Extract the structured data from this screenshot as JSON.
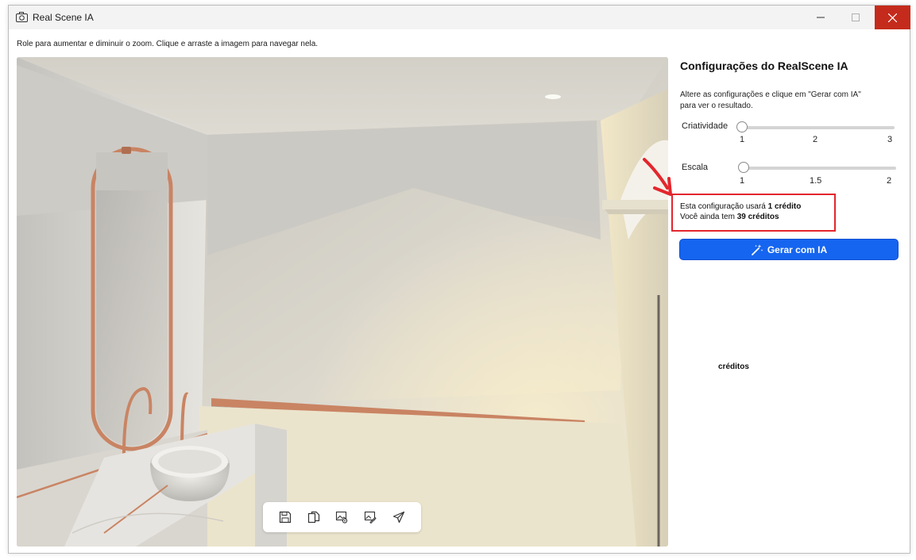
{
  "window": {
    "title": "Real Scene IA",
    "controls": {
      "minimize": "minimize",
      "maximize": "maximize",
      "close": "close"
    }
  },
  "hint": "Role para aumentar e diminuir o zoom. Clique e arraste a imagem para navegar nela.",
  "viewer": {
    "toolbar": [
      {
        "name": "save-button",
        "icon": "floppy-disk-icon"
      },
      {
        "name": "copy-button",
        "icon": "copy-icon"
      },
      {
        "name": "image-settings-button",
        "icon": "image-gear-icon"
      },
      {
        "name": "image-edit-button",
        "icon": "image-edit-icon"
      },
      {
        "name": "send-button",
        "icon": "paper-plane-icon"
      }
    ]
  },
  "panel": {
    "title": "Configurações do RealScene IA",
    "description_line1": "Altere as configurações e clique em \"Gerar com IA\"",
    "description_line2": "para ver o resultado.",
    "sliders": {
      "criatividade": {
        "label": "Criatividade",
        "min": "1",
        "mid": "2",
        "max": "3",
        "value": 1
      },
      "escala": {
        "label": "Escala",
        "min": "1",
        "mid": "1.5",
        "max": "2",
        "value": 1
      }
    },
    "credits": {
      "line1_prefix": "Esta configuração usará ",
      "line1_bold": "1 crédito",
      "line2_prefix": "Você ainda tem ",
      "line2_bold": "39 créditos"
    },
    "generate_label": "Gerar com IA",
    "extra_label": "créditos"
  },
  "colors": {
    "accent": "#1565f0",
    "close": "#c42b1c",
    "highlight": "#e3262d",
    "copper": "#c98463"
  }
}
